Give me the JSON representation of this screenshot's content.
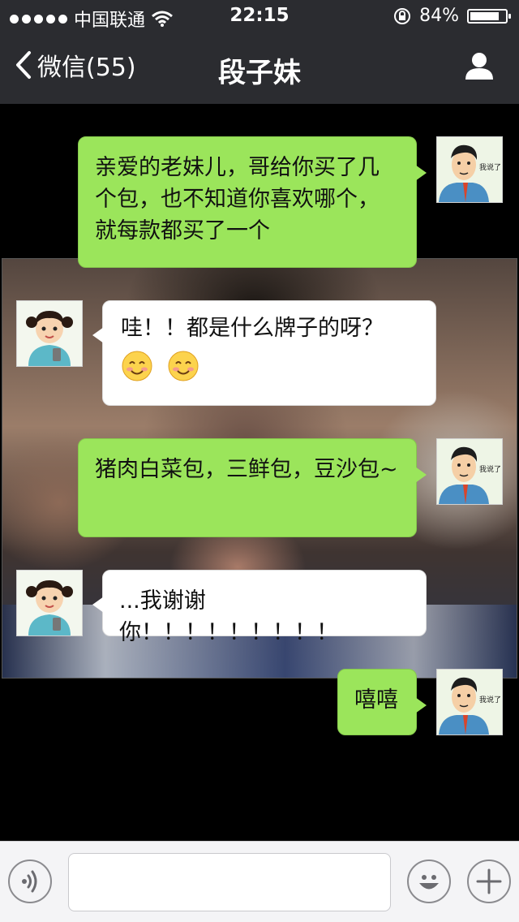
{
  "status_bar": {
    "carrier": "中国联通",
    "time": "22:15",
    "battery": "84%",
    "battery_level": 0.84,
    "icons": [
      "signal-dots-icon",
      "wifi-icon",
      "rotation-lock-icon",
      "battery-icon"
    ]
  },
  "nav": {
    "back_label": "微信(55)",
    "title": "段子妹",
    "icons": [
      "chevron-left-icon",
      "person-icon"
    ]
  },
  "messages": [
    {
      "side": "right",
      "sender": "me",
      "text": "亲爱的老妹儿，哥给你买了几个包，也不知道你喜欢哪个，就每款都买了一个"
    },
    {
      "side": "left",
      "sender": "girl",
      "text": "哇！！都是什么牌子的呀？",
      "emojis": [
        "smiling-face-icon",
        "smiling-face-icon"
      ]
    },
    {
      "side": "right",
      "sender": "me",
      "text": "猪肉白菜包，三鲜包，豆沙包~"
    },
    {
      "side": "left",
      "sender": "girl",
      "text": "...我谢谢你！！！！！！！！！"
    },
    {
      "side": "right",
      "sender": "me",
      "text": "嘻嘻"
    }
  ],
  "avatars": {
    "me_caption": "我说了，我。。。"
  },
  "input_bar": {
    "icons": [
      "voice-icon",
      "emoji-face-icon",
      "plus-icon"
    ],
    "placeholder": ""
  },
  "colors": {
    "nav_bg": "#2b2c30",
    "bubble_green": "#9be55b",
    "bubble_white": "#ffffff",
    "chat_bg": "#000000"
  }
}
